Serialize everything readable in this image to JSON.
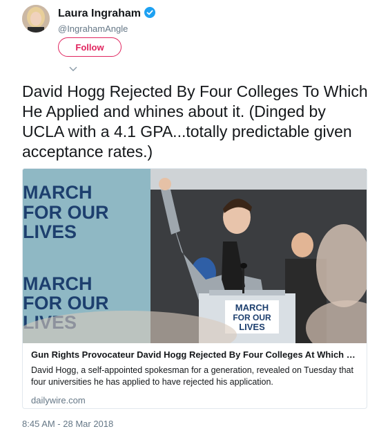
{
  "author": {
    "name": "Laura Ingraham",
    "handle": "@IngrahamAngle",
    "verified": true
  },
  "follow_label": "Follow",
  "tweet": {
    "text": "David Hogg Rejected By Four Colleges To Which He Applied and whines about it. (Dinged by UCLA with a 4.1 GPA...totally predictable given acceptance rates.)"
  },
  "card": {
    "image_sign_top": [
      "MARCH",
      "FOR OUR",
      "LIVES"
    ],
    "image_sign_bottom": [
      "MARCH",
      "FOR OUR",
      "LIVES"
    ],
    "podium_sign": [
      "MARCH",
      "FOR OUR",
      "LIVES"
    ],
    "title": "Gun Rights Provocateur David Hogg Rejected By Four Colleges At Which He …",
    "description": "David Hogg, a self-appointed spokesman for a generation, revealed on Tuesday that four universities he has applied to have rejected his application.",
    "domain": "dailywire.com"
  },
  "timestamp": "8:45 AM - 28 Mar 2018",
  "colors": {
    "follow_accent": "#e0245e",
    "verified_blue": "#1da1f2",
    "secondary_text": "#657786",
    "sign_teal": "#8fb8c4",
    "sign_navy": "#1d3f6e"
  }
}
